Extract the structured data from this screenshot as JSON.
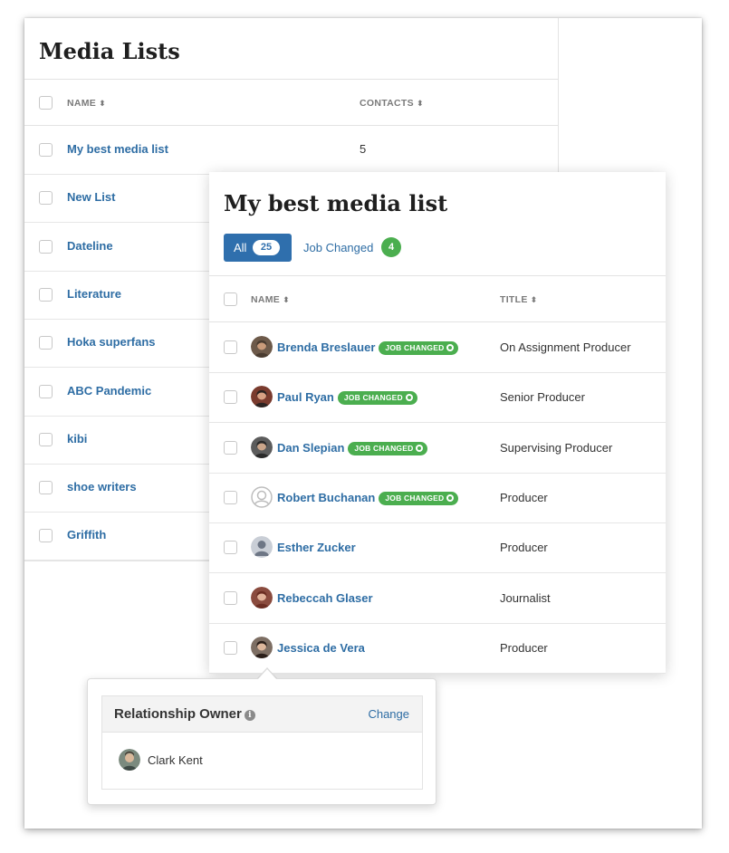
{
  "media_lists": {
    "title": "Media Lists",
    "columns": {
      "name": "NAME",
      "contacts": "CONTACTS"
    },
    "sort_glyph": "⬍",
    "rows": [
      {
        "name": "My best media list",
        "contacts": "5"
      },
      {
        "name": "New List",
        "contacts": ""
      },
      {
        "name": "Dateline",
        "contacts": ""
      },
      {
        "name": "Literature",
        "contacts": ""
      },
      {
        "name": "Hoka superfans",
        "contacts": ""
      },
      {
        "name": "ABC Pandemic",
        "contacts": ""
      },
      {
        "name": "kibi",
        "contacts": ""
      },
      {
        "name": "shoe writers",
        "contacts": ""
      },
      {
        "name": "Griffith",
        "contacts": ""
      }
    ]
  },
  "detail": {
    "title": "My best media list",
    "tabs": {
      "all": {
        "label": "All",
        "count": "25"
      },
      "job_changed": {
        "label": "Job Changed",
        "count": "4"
      }
    },
    "columns": {
      "name": "NAME",
      "title": "TITLE"
    },
    "badge_label": "JOB CHANGED",
    "contacts": [
      {
        "name": "Brenda Breslauer",
        "title": "On Assignment Producer",
        "job_changed": true,
        "avatar": "photo-avatar"
      },
      {
        "name": "Paul Ryan",
        "title": "Senior Producer",
        "job_changed": true,
        "avatar": "photo-avatar"
      },
      {
        "name": "Dan Slepian",
        "title": "Supervising Producer",
        "job_changed": true,
        "avatar": "photo-avatar"
      },
      {
        "name": "Robert Buchanan",
        "title": "Producer",
        "job_changed": true,
        "avatar": "placeholder-outline-avatar"
      },
      {
        "name": "Esther Zucker",
        "title": "Producer",
        "job_changed": false,
        "avatar": "placeholder-avatar"
      },
      {
        "name": "Rebeccah Glaser",
        "title": "Journalist",
        "job_changed": false,
        "avatar": "photo-avatar"
      },
      {
        "name": "Jessica de Vera",
        "title": "Producer",
        "job_changed": false,
        "avatar": "photo-avatar"
      }
    ]
  },
  "popover": {
    "title": "Relationship Owner",
    "info_glyph": "i",
    "change_label": "Change",
    "owner_name": "Clark Kent"
  },
  "colors": {
    "link_blue": "#2e6da4",
    "tab_active": "#2f6fad",
    "badge_green": "#4bae4f"
  }
}
